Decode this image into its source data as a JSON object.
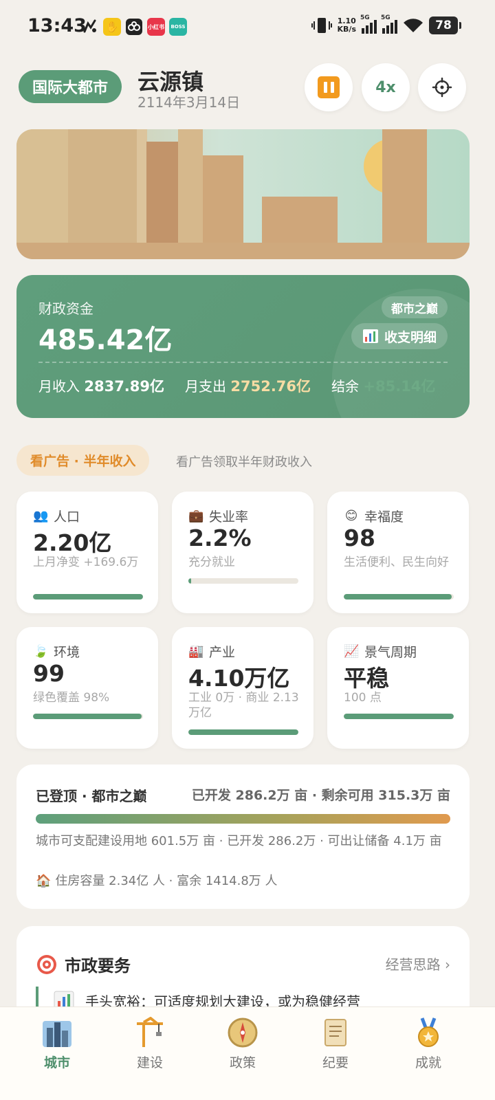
{
  "status_bar": {
    "time": "13:43",
    "net_speed_value": "1.10",
    "net_speed_unit": "KB/s",
    "sim1": "5G",
    "sim2": "5G",
    "battery": "78",
    "app_icons": [
      "xianyu-icon",
      "hand-icon",
      "cloud-icon",
      "xiaohongshu-icon",
      "boss-icon"
    ]
  },
  "header": {
    "level_badge": "国际大都市",
    "city_name": "云源镇",
    "date": "2114年3月14日",
    "speed_label": "4x",
    "pause_color": "#f29a1e",
    "accent": "#5b9c78"
  },
  "finance": {
    "label": "财政资金",
    "value": "485.42亿",
    "tier_badge": "都市之巅",
    "detail_button": "收支明细",
    "income_label": "月收入",
    "income_value": "2837.89亿",
    "expense_label": "月支出",
    "expense_value": "2752.76亿",
    "balance_label": "结余",
    "balance_value": "+85.14亿"
  },
  "ad": {
    "button": "看广告 · 半年收入",
    "description": "看广告领取半年财政收入"
  },
  "stats": [
    {
      "icon": "people-icon",
      "glyph": "👥",
      "label": "人口",
      "value": "2.20亿",
      "sub": "上月净变 +169.6万",
      "progress": 1.0
    },
    {
      "icon": "briefcase-icon",
      "glyph": "💼",
      "label": "失业率",
      "value": "2.2%",
      "sub": "充分就业",
      "progress": 0.022
    },
    {
      "icon": "smile-icon",
      "glyph": "😊",
      "label": "幸福度",
      "value": "98",
      "sub": "生活便利、民生向好",
      "progress": 0.98
    },
    {
      "icon": "leaf-icon",
      "glyph": "🍃",
      "label": "环境",
      "value": "99",
      "sub": "绿色覆盖 98%",
      "progress": 0.99
    },
    {
      "icon": "factory-icon",
      "glyph": "🏭",
      "label": "产业",
      "value": "4.10万亿",
      "sub": "工业 0万 · 商业 2.13万亿",
      "progress": 1.0
    },
    {
      "icon": "chart-up-icon",
      "glyph": "📈",
      "label": "景气周期",
      "value": "平稳",
      "sub": "100 点",
      "progress": 1.0
    }
  ],
  "land": {
    "title": "已登顶 · 都市之巅",
    "summary": "已开发 286.2万 亩 · 剩余可用 315.3万 亩",
    "detail": "城市可支配建设用地 601.5万 亩 · 已开发 286.2万 · 可出让储备 4.1万 亩",
    "housing_icon": "house-icon",
    "housing": "住房容量 2.34亿 人 · 富余 1414.8万 人"
  },
  "affairs": {
    "title": "市政要务",
    "title_icon": "target-icon",
    "link": "经营思路 ›",
    "tip_icon": "bar-chart-icon",
    "tip": "手头宽裕：可适度规划大建设，或为稳健经营"
  },
  "tabs": [
    {
      "label": "城市",
      "icon": "city-icon",
      "active": true
    },
    {
      "label": "建设",
      "icon": "crane-icon",
      "active": false
    },
    {
      "label": "政策",
      "icon": "compass-icon",
      "active": false
    },
    {
      "label": "纪要",
      "icon": "scroll-icon",
      "active": false
    },
    {
      "label": "成就",
      "icon": "medal-icon",
      "active": false
    }
  ]
}
